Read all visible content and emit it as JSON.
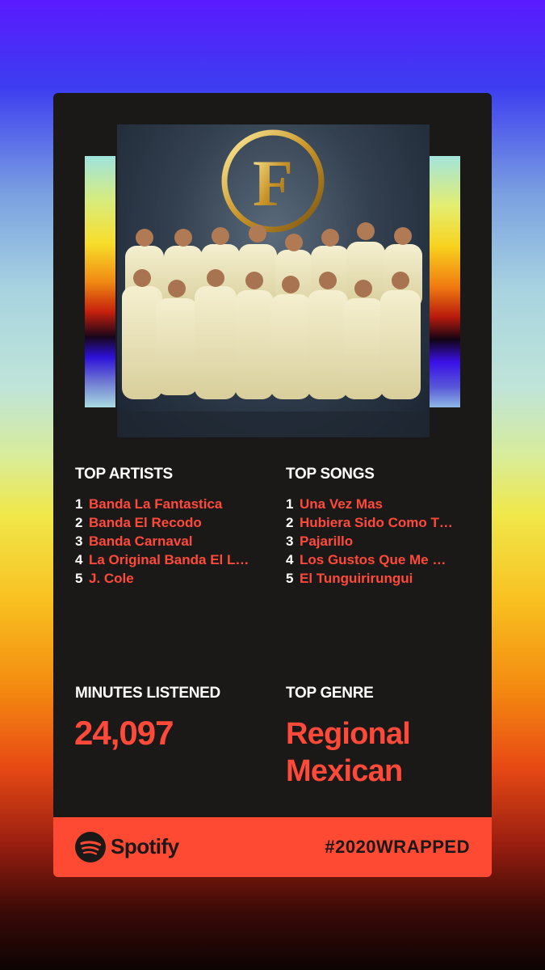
{
  "top_artists": {
    "heading": "TOP ARTISTS",
    "items": [
      {
        "rank": "1",
        "name": "Banda La Fantastica"
      },
      {
        "rank": "2",
        "name": "Banda El Recodo"
      },
      {
        "rank": "3",
        "name": "Banda Carnaval"
      },
      {
        "rank": "4",
        "name": "La Original Banda El L…"
      },
      {
        "rank": "5",
        "name": "J. Cole"
      }
    ]
  },
  "top_songs": {
    "heading": "TOP SONGS",
    "items": [
      {
        "rank": "1",
        "name": "Una Vez Mas"
      },
      {
        "rank": "2",
        "name": "Hubiera Sido Como T…"
      },
      {
        "rank": "3",
        "name": "Pajarillo"
      },
      {
        "rank": "4",
        "name": "Los Gustos Que Me …"
      },
      {
        "rank": "5",
        "name": "El Tunguirirungui"
      }
    ]
  },
  "minutes": {
    "heading": "MINUTES LISTENED",
    "value": "24,097"
  },
  "genre": {
    "heading": "TOP GENRE",
    "line1": "Regional",
    "line2": "Mexican"
  },
  "footer": {
    "brand": "Spotify",
    "hashtag": "#2020WRAPPED"
  },
  "colors": {
    "accent": "#ff4a3a",
    "card": "#1b1818",
    "footer": "#ff4a33"
  },
  "artwork": {
    "logo_letter": "F"
  }
}
